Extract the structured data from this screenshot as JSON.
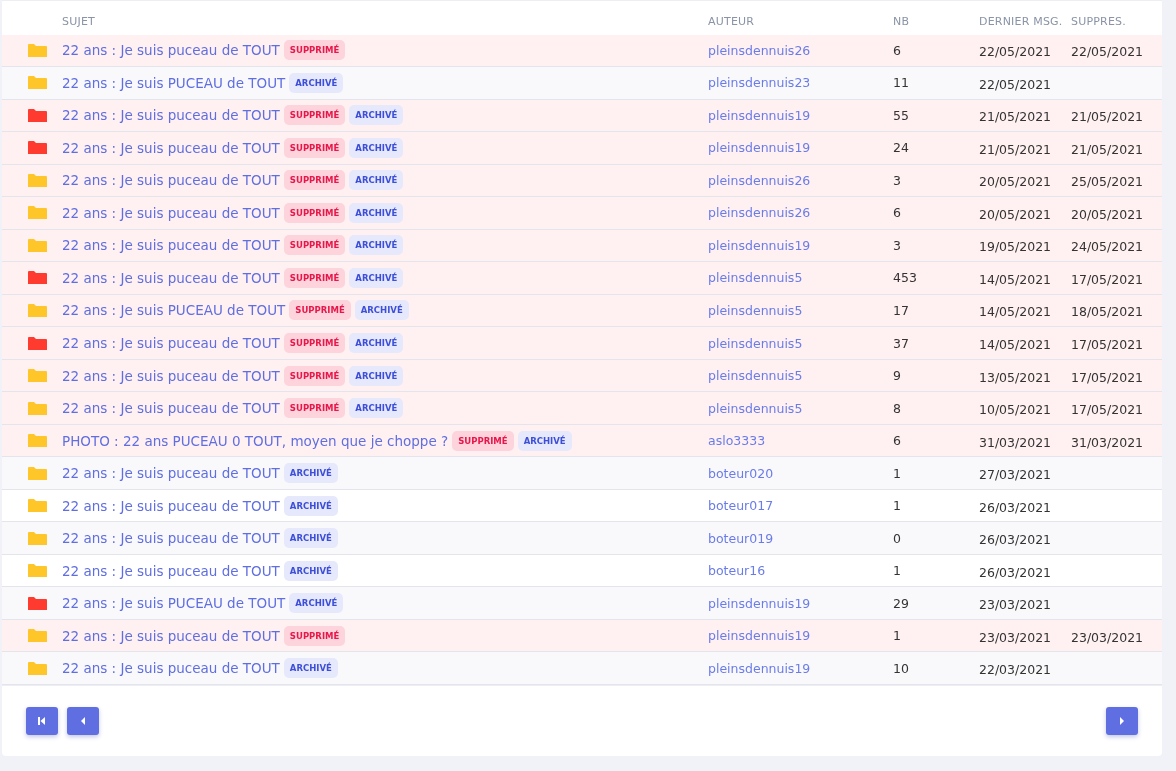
{
  "table": {
    "columns": [
      "SUJET",
      "AUTEUR",
      "NB",
      "DERNIER MSG.",
      "SUPPRES."
    ],
    "rows": [
      {
        "color": "#ffc629",
        "subject": "22 ans : Je suis puceau de TOUT",
        "badges": [
          {
            "kind": "deleted",
            "label": "SUPPRIMÉ"
          }
        ],
        "author": "pleinsdennuis26",
        "nb": "6",
        "last": "22/05/2021",
        "deleted": "22/05/2021"
      },
      {
        "color": "#ffc629",
        "subject": "22 ans : Je suis PUCEAU de TOUT",
        "badges": [
          {
            "kind": "archived",
            "label": "ARCHIVÉ"
          }
        ],
        "author": "pleinsdennuis23",
        "nb": "11",
        "last": "22/05/2021"
      },
      {
        "color": "#ff3b30",
        "subject": "22 ans : Je suis puceau de TOUT",
        "badges": [
          {
            "kind": "deleted",
            "label": "SUPPRIMÉ"
          },
          {
            "kind": "archived",
            "label": "ARCHIVÉ"
          }
        ],
        "author": "pleinsdennuis19",
        "nb": "55",
        "last": "21/05/2021",
        "deleted": "21/05/2021"
      },
      {
        "color": "#ff3b30",
        "subject": "22 ans : Je suis puceau de TOUT",
        "badges": [
          {
            "kind": "deleted",
            "label": "SUPPRIMÉ"
          },
          {
            "kind": "archived",
            "label": "ARCHIVÉ"
          }
        ],
        "author": "pleinsdennuis19",
        "nb": "24",
        "last": "21/05/2021",
        "deleted": "21/05/2021"
      },
      {
        "color": "#ffc629",
        "subject": "22 ans : Je suis puceau de TOUT",
        "badges": [
          {
            "kind": "deleted",
            "label": "SUPPRIMÉ"
          },
          {
            "kind": "archived",
            "label": "ARCHIVÉ"
          }
        ],
        "author": "pleinsdennuis26",
        "nb": "3",
        "last": "20/05/2021",
        "deleted": "25/05/2021"
      },
      {
        "color": "#ffc629",
        "subject": "22 ans : Je suis puceau de TOUT",
        "badges": [
          {
            "kind": "deleted",
            "label": "SUPPRIMÉ"
          },
          {
            "kind": "archived",
            "label": "ARCHIVÉ"
          }
        ],
        "author": "pleinsdennuis26",
        "nb": "6",
        "last": "20/05/2021",
        "deleted": "20/05/2021"
      },
      {
        "color": "#ffc629",
        "subject": "22 ans : Je suis puceau de TOUT",
        "badges": [
          {
            "kind": "deleted",
            "label": "SUPPRIMÉ"
          },
          {
            "kind": "archived",
            "label": "ARCHIVÉ"
          }
        ],
        "author": "pleinsdennuis19",
        "nb": "3",
        "last": "19/05/2021",
        "deleted": "24/05/2021"
      },
      {
        "color": "#ff3b30",
        "subject": "22 ans : Je suis puceau de TOUT",
        "badges": [
          {
            "kind": "deleted",
            "label": "SUPPRIMÉ"
          },
          {
            "kind": "archived",
            "label": "ARCHIVÉ"
          }
        ],
        "author": "pleinsdennuis5",
        "nb": "453",
        "last": "14/05/2021",
        "deleted": "17/05/2021"
      },
      {
        "color": "#ffc629",
        "subject": "22 ans : Je suis PUCEAU de TOUT",
        "badges": [
          {
            "kind": "deleted",
            "label": "SUPPRIMÉ"
          },
          {
            "kind": "archived",
            "label": "ARCHIVÉ"
          }
        ],
        "author": "pleinsdennuis5",
        "nb": "17",
        "last": "14/05/2021",
        "deleted": "18/05/2021"
      },
      {
        "color": "#ff3b30",
        "subject": "22 ans : Je suis puceau de TOUT",
        "badges": [
          {
            "kind": "deleted",
            "label": "SUPPRIMÉ"
          },
          {
            "kind": "archived",
            "label": "ARCHIVÉ"
          }
        ],
        "author": "pleinsdennuis5",
        "nb": "37",
        "last": "14/05/2021",
        "deleted": "17/05/2021"
      },
      {
        "color": "#ffc629",
        "subject": "22 ans : Je suis puceau de TOUT",
        "badges": [
          {
            "kind": "deleted",
            "label": "SUPPRIMÉ"
          },
          {
            "kind": "archived",
            "label": "ARCHIVÉ"
          }
        ],
        "author": "pleinsdennuis5",
        "nb": "9",
        "last": "13/05/2021",
        "deleted": "17/05/2021"
      },
      {
        "color": "#ffc629",
        "subject": "22 ans : Je suis puceau de TOUT",
        "badges": [
          {
            "kind": "deleted",
            "label": "SUPPRIMÉ"
          },
          {
            "kind": "archived",
            "label": "ARCHIVÉ"
          }
        ],
        "author": "pleinsdennuis5",
        "nb": "8",
        "last": "10/05/2021",
        "deleted": "17/05/2021"
      },
      {
        "color": "#ffc629",
        "subject": "PHOTO : 22 ans PUCEAU 0 TOUT, moyen que je choppe ?",
        "badges": [
          {
            "kind": "deleted",
            "label": "SUPPRIMÉ"
          },
          {
            "kind": "archived",
            "label": "ARCHIVÉ"
          }
        ],
        "author": "aslo3333",
        "nb": "6",
        "last": "31/03/2021",
        "deleted": "31/03/2021"
      },
      {
        "color": "#ffc629",
        "subject": "22 ans : Je suis puceau de TOUT",
        "badges": [
          {
            "kind": "archived",
            "label": "ARCHIVÉ"
          }
        ],
        "author": "boteur020",
        "nb": "1",
        "last": "27/03/2021"
      },
      {
        "color": "#ffc629",
        "subject": "22 ans : Je suis puceau de TOUT",
        "badges": [
          {
            "kind": "archived",
            "label": "ARCHIVÉ"
          }
        ],
        "author": "boteur017",
        "nb": "1",
        "last": "26/03/2021"
      },
      {
        "color": "#ffc629",
        "subject": "22 ans : Je suis puceau de TOUT",
        "badges": [
          {
            "kind": "archived",
            "label": "ARCHIVÉ"
          }
        ],
        "author": "boteur019",
        "nb": "0",
        "last": "26/03/2021"
      },
      {
        "color": "#ffc629",
        "subject": "22 ans : Je suis puceau de TOUT",
        "badges": [
          {
            "kind": "archived",
            "label": "ARCHIVÉ"
          }
        ],
        "author": "boteur16",
        "nb": "1",
        "last": "26/03/2021"
      },
      {
        "color": "#ff3b30",
        "subject": "22 ans : Je suis PUCEAU de TOUT",
        "badges": [
          {
            "kind": "archived",
            "label": "ARCHIVÉ"
          }
        ],
        "author": "pleinsdennuis19",
        "nb": "29",
        "last": "23/03/2021"
      },
      {
        "color": "#ffc629",
        "subject": "22 ans : Je suis puceau de TOUT",
        "badges": [
          {
            "kind": "deleted",
            "label": "SUPPRIMÉ"
          }
        ],
        "author": "pleinsdennuis19",
        "nb": "1",
        "last": "23/03/2021",
        "deleted": "23/03/2021"
      },
      {
        "color": "#ffc629",
        "subject": "22 ans : Je suis puceau de TOUT",
        "badges": [
          {
            "kind": "archived",
            "label": "ARCHIVÉ"
          }
        ],
        "author": "pleinsdennuis19",
        "nb": "10",
        "last": "22/03/2021"
      }
    ]
  },
  "pagination": [
    {
      "kind": "first"
    },
    {
      "kind": "prev"
    },
    {
      "kind": "next"
    }
  ]
}
